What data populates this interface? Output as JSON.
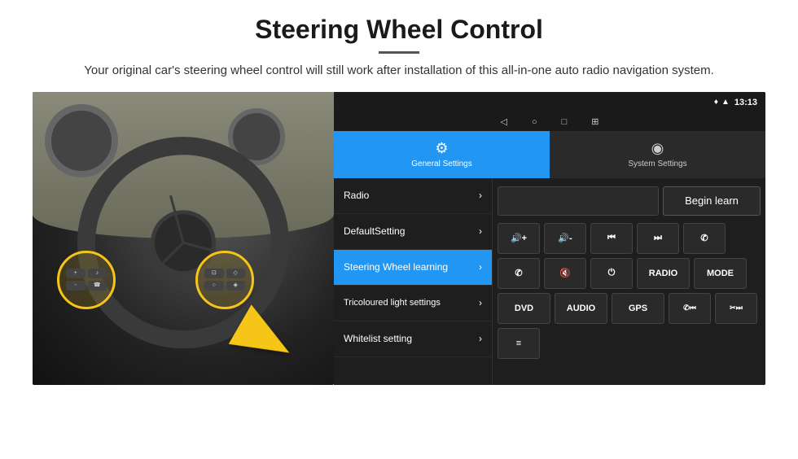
{
  "page": {
    "title": "Steering Wheel Control",
    "subtitle": "Your original car's steering wheel control will still work after installation of this all-in-one auto radio navigation system."
  },
  "statusBar": {
    "time": "13:13",
    "location_icon": "♦",
    "signal_icon": "▲",
    "wifi_icon": "◈"
  },
  "navBar": {
    "back_icon": "◁",
    "home_icon": "○",
    "square_icon": "□",
    "grid_icon": "⊞"
  },
  "tabs": [
    {
      "id": "general",
      "label": "General Settings",
      "icon": "⚙",
      "active": true
    },
    {
      "id": "system",
      "label": "System Settings",
      "icon": "◉",
      "active": false
    }
  ],
  "menuItems": [
    {
      "id": "radio",
      "label": "Radio",
      "active": false
    },
    {
      "id": "default",
      "label": "DefaultSetting",
      "active": false
    },
    {
      "id": "steering",
      "label": "Steering Wheel learning",
      "active": true
    },
    {
      "id": "tricoloured",
      "label": "Tricoloured light settings",
      "active": false
    },
    {
      "id": "whitelist",
      "label": "Whitelist setting",
      "active": false
    }
  ],
  "controls": {
    "beginLearnLabel": "Begin learn",
    "buttons": {
      "row1": [
        "🔊+",
        "🔊-",
        "⏮",
        "⏭",
        "✆"
      ],
      "row2": [
        "✆",
        "🔇",
        "⏻",
        "RADIO",
        "MODE"
      ],
      "row3": [
        "DVD",
        "AUDIO",
        "GPS",
        "✆⏮",
        "✂⏭"
      ],
      "row4": [
        "≡"
      ]
    }
  }
}
